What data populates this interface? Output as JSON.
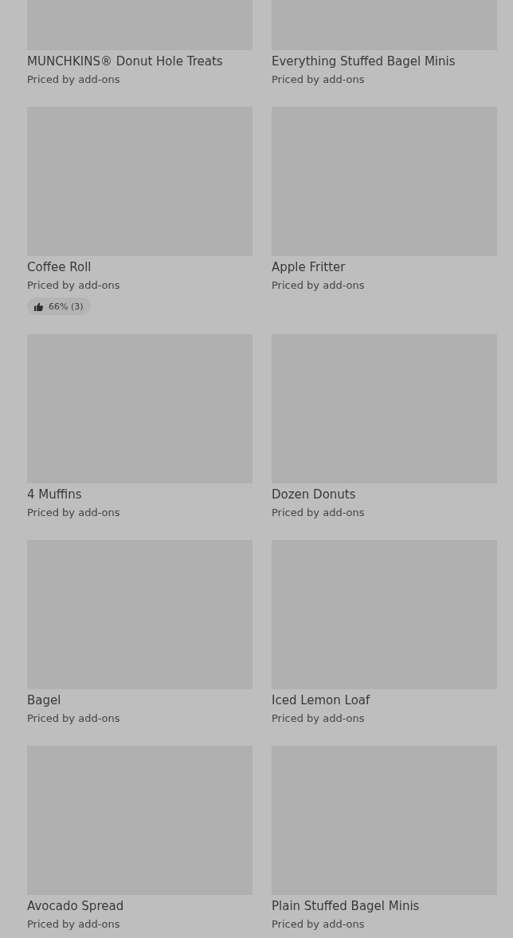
{
  "items": [
    {
      "name": "MUNCHKINS® Donut Hole Treats",
      "price": "Priced by add-ons"
    },
    {
      "name": "Everything Stuffed Bagel Minis",
      "price": "Priced by add-ons"
    },
    {
      "name": "Coffee Roll",
      "price": "Priced by add-ons",
      "rating": "66% (3)"
    },
    {
      "name": "Apple Fritter",
      "price": "Priced by add-ons"
    },
    {
      "name": "4 Muffins",
      "price": "Priced by add-ons"
    },
    {
      "name": "Dozen Donuts",
      "price": "Priced by add-ons"
    },
    {
      "name": "Bagel",
      "price": "Priced by add-ons"
    },
    {
      "name": "Iced Lemon Loaf",
      "price": "Priced by add-ons"
    },
    {
      "name": "Avocado Spread",
      "price": "Priced by add-ons"
    },
    {
      "name": "Plain Stuffed Bagel Minis",
      "price": "Priced by add-ons"
    }
  ]
}
